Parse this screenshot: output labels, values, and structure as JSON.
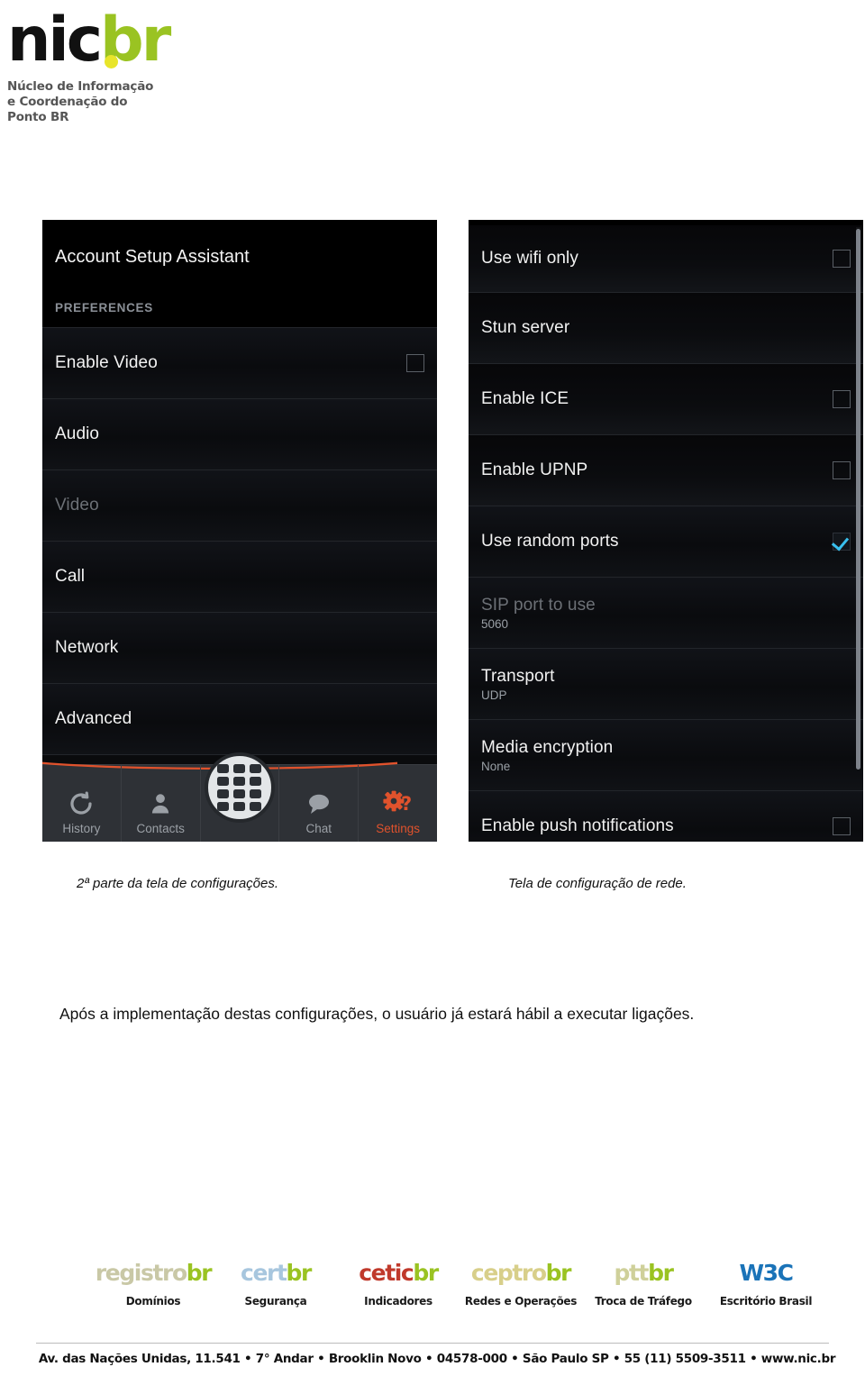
{
  "brand": {
    "logo_nic": "nic",
    "logo_br": "br",
    "tagline_line1": "Núcleo de Informação",
    "tagline_line2": "e Coordenação do",
    "tagline_line3": "Ponto BR",
    "accent_green": "#9ac322",
    "accent_yellow": "#e8e52a"
  },
  "screenshot_left": {
    "title": "Account Setup Assistant",
    "section_header": "PREFERENCES",
    "items": [
      {
        "label": "Enable Video",
        "checkbox": true,
        "checked": false,
        "disabled": false
      },
      {
        "label": "Audio",
        "checkbox": false,
        "checked": false,
        "disabled": false
      },
      {
        "label": "Video",
        "checkbox": false,
        "checked": false,
        "disabled": true
      },
      {
        "label": "Call",
        "checkbox": false,
        "checked": false,
        "disabled": false
      },
      {
        "label": "Network",
        "checkbox": false,
        "checked": false,
        "disabled": false
      },
      {
        "label": "Advanced",
        "checkbox": false,
        "checked": false,
        "disabled": false
      }
    ],
    "tabs": [
      {
        "label": "History",
        "icon": "refresh-icon",
        "active": false
      },
      {
        "label": "Contacts",
        "icon": "person-icon",
        "active": false
      },
      {
        "label": "",
        "icon": "dialpad-icon",
        "active": false
      },
      {
        "label": "Chat",
        "icon": "speech-bubble-icon",
        "active": false
      },
      {
        "label": "Settings",
        "icon": "gear-question-icon",
        "active": true
      }
    ],
    "accent_color": "#e0522c"
  },
  "screenshot_right": {
    "items": [
      {
        "label": "Use wifi only",
        "value": "",
        "checkbox": true,
        "checked": false,
        "disabled": false
      },
      {
        "label": "Stun server",
        "value": "",
        "checkbox": false,
        "checked": false,
        "disabled": false
      },
      {
        "label": "Enable ICE",
        "value": "",
        "checkbox": true,
        "checked": false,
        "disabled": false
      },
      {
        "label": "Enable UPNP",
        "value": "",
        "checkbox": true,
        "checked": false,
        "disabled": false
      },
      {
        "label": "Use random ports",
        "value": "",
        "checkbox": true,
        "checked": true,
        "disabled": false
      },
      {
        "label": "SIP port to use",
        "value": "5060",
        "checkbox": false,
        "checked": false,
        "disabled": true
      },
      {
        "label": "Transport",
        "value": "UDP",
        "checkbox": false,
        "checked": false,
        "disabled": false
      },
      {
        "label": "Media encryption",
        "value": "None",
        "checkbox": false,
        "checked": false,
        "disabled": false
      },
      {
        "label": "Enable push notifications",
        "value": "",
        "checkbox": true,
        "checked": false,
        "disabled": false
      }
    ],
    "check_color": "#39c0ee"
  },
  "captions": {
    "left": "2ª parte da tela de configurações.",
    "right": "Tela de configuração de rede."
  },
  "body": {
    "paragraph": "Após a implementação destas configurações, o usuário já estará hábil a executar ligações."
  },
  "footer": {
    "logos": [
      {
        "name": "registro",
        "suffix": "br",
        "caption": "Domínios"
      },
      {
        "name": "cert",
        "suffix": "br",
        "caption": "Segurança"
      },
      {
        "name": "cetic",
        "suffix": "br",
        "caption": "Indicadores"
      },
      {
        "name": "ceptro",
        "suffix": "br",
        "caption": "Redes e Operações"
      },
      {
        "name": "ptt",
        "suffix": "br",
        "caption": "Troca de Tráfego"
      },
      {
        "name": "W3C",
        "suffix": "",
        "caption": "Escritório Brasil"
      }
    ],
    "address": "Av. das Nações Unidas, 11.541 • 7° Andar • Brooklin Novo • 04578-000 • São Paulo SP • 55 (11) 5509-3511 • www.nic.br"
  }
}
